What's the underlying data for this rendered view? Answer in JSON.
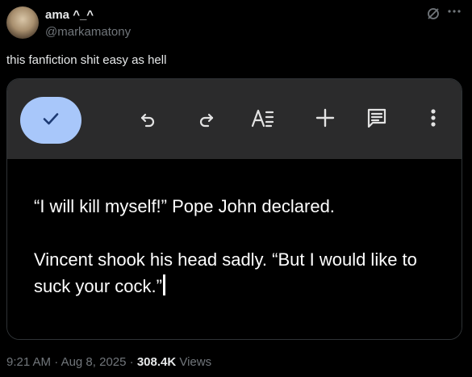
{
  "author": {
    "name": "ama ^_^",
    "handle": "@markamatony"
  },
  "tweet": {
    "text": "this fanfiction shit easy as hell"
  },
  "editor": {
    "paragraph1": "“I will kill myself!” Pope John declared.",
    "paragraph2": "Vincent shook his head sadly. “But I would like to suck your cock.”"
  },
  "meta": {
    "time": "9:21 AM",
    "sep1": " · ",
    "date": "Aug 8, 2025",
    "sep2": " · ",
    "views_count": "308.4K",
    "views_label": " Views"
  },
  "icons": {
    "check": "check-icon",
    "undo": "undo-icon",
    "redo": "redo-icon",
    "text_format": "text-format-icon",
    "add": "add-icon",
    "comment": "comment-icon",
    "more": "more-vert-icon"
  },
  "colors": {
    "background": "#000000",
    "toolbar": "#2b2b2c",
    "accent_button": "#a8c7fa",
    "secondary_text": "#71767b"
  }
}
